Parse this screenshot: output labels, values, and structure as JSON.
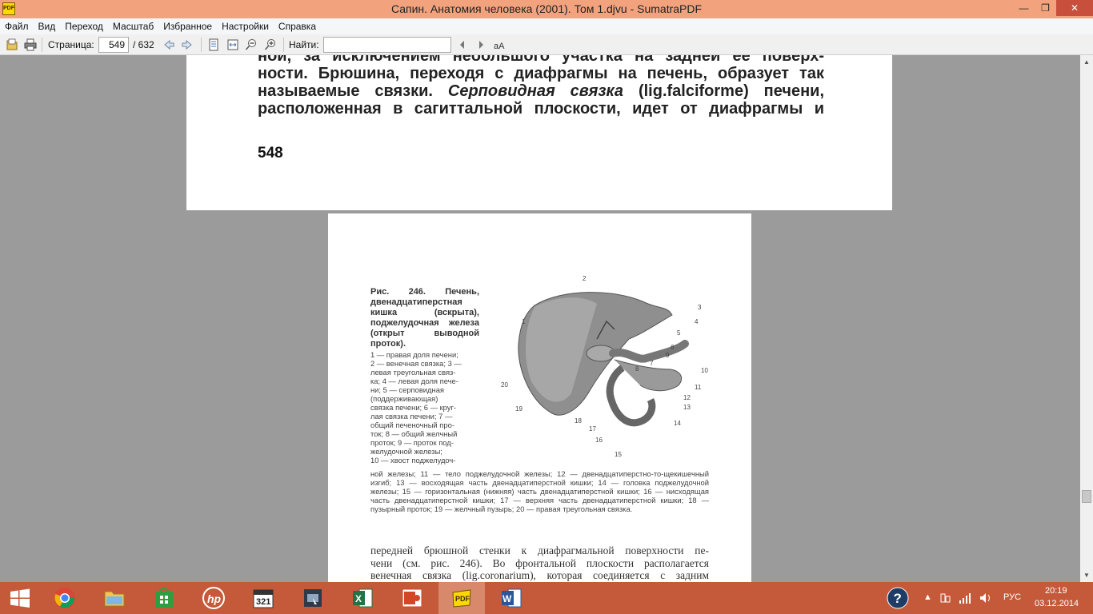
{
  "window": {
    "title": "Сапин. Анатомия человека (2001). Том 1.djvu - SumatraPDF",
    "app_icon_label": "PDF",
    "controls": {
      "minimize": "—",
      "restore": "❐",
      "close": "✕"
    }
  },
  "menu": [
    "Файл",
    "Вид",
    "Переход",
    "Масштаб",
    "Избранное",
    "Настройки",
    "Справка"
  ],
  "toolbar": {
    "page_label": "Страница:",
    "page_value": "549",
    "page_total": "/ 632",
    "find_label": "Найти:",
    "find_value": ""
  },
  "page1": {
    "lines": [
      "ной, за исключением небольшого участка на задней ее поверх-",
      "ности. Брюшина, переходя с диафрагмы на печень, образует так",
      "называемые связки.",
      "Серповидная связка",
      "(lig.falciforme) печени,",
      "расположенная в сагиттальной плоскости, идет от диафрагмы и"
    ],
    "page_number": "548"
  },
  "page2": {
    "caption_title": "Рис. 246. Печень, двенадцатиперстная кишка (вскрыта), поджелудочная железа (открыт выводной проток).",
    "caption_short": "1 — правая доля печени;\n2 — венечная связка; 3 —\nлевая треугольная связ-\nка; 4 — левая доля пече-\nни; 5 — серповидная\n(поддерживающая)\nсвязка печени; 6 — круг-\nлая связка печени; 7 —\nобщий печеночный про-\nток; 8 — общий желчный\nпроток; 9 — проток под-\nжелудочной железы;\n10 — хвост поджелудоч-",
    "caption_long": "ной железы; 11 — тело поджелудочной железы; 12 — двенадцатиперстно-то-щекишечный изгиб; 13 — восходящая часть двенадцатиперстной кишки; 14 — головка поджелудочной железы; 15 — горизонтальная (нижняя) часть двенадцатиперстной кишки; 16 — нисходящая часть двенадцатиперстной кишки; 17 — верхняя часть двенадцатиперстной кишки; 18 — пузырный проток; 19 — желчный пузырь; 20 — правая треугольная связка.",
    "body_lines": [
      "передней брюшной стенки к диафрагмальной поверхности пе-",
      "чени (см. рис. 246). Во фронтальной плоскости располагается",
      "венечная связка (lig.coronarium), которая соединяется с задним"
    ],
    "figure_labels": [
      "1",
      "2",
      "3",
      "4",
      "5",
      "6",
      "7",
      "8",
      "9",
      "10",
      "11",
      "12",
      "13",
      "14",
      "15",
      "16",
      "17",
      "18",
      "19",
      "20"
    ]
  },
  "taskbar": {
    "apps": [
      "chrome",
      "file-explorer",
      "store",
      "hp",
      "calendar-321",
      "camera",
      "excel",
      "powerpoint",
      "sumatrapdf",
      "word"
    ],
    "active_app": "sumatrapdf",
    "language": "РУС",
    "time": "20:19",
    "date": "03.12.2014"
  },
  "colors": {
    "titlebar": "#f2a37e",
    "taskbar": "#c55a3a",
    "close_button": "#c74f3b",
    "background": "#9b9b9b"
  }
}
